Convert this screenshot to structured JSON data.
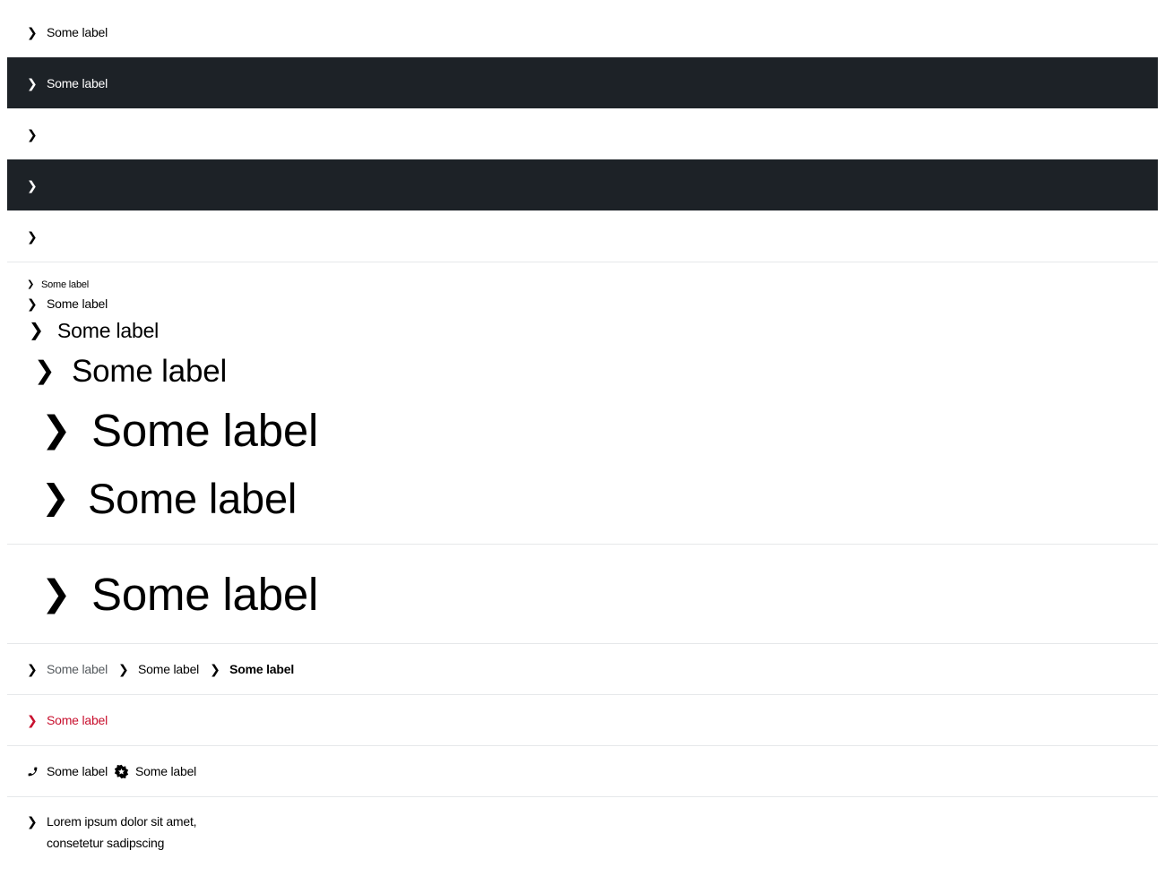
{
  "rows": {
    "r1": {
      "chevron": "❯",
      "label": "Some label"
    },
    "r2": {
      "chevron": "❯",
      "label": "Some label"
    },
    "r3": {
      "chevron": "❯"
    },
    "r4": {
      "chevron": "❯"
    },
    "r5": {
      "chevron": "❯"
    }
  },
  "sizes": {
    "xs": {
      "chevron": "❯",
      "label": "Some label"
    },
    "s": {
      "chevron": "❯",
      "label": "Some label"
    },
    "m": {
      "chevron": "❯",
      "label": "Some label"
    },
    "l": {
      "chevron": "❯",
      "label": "Some label"
    },
    "xl": {
      "chevron": "❯",
      "label": "Some label"
    },
    "xl2": {
      "chevron": "❯",
      "label": "Some label"
    }
  },
  "hero": {
    "chevron": "❯",
    "label": "Some label"
  },
  "weights": [
    {
      "chevron": "❯",
      "label": "Some label",
      "variant": "light"
    },
    {
      "chevron": "❯",
      "label": "Some label",
      "variant": "regular"
    },
    {
      "chevron": "❯",
      "label": "Some label",
      "variant": "bold"
    }
  ],
  "red_link": {
    "chevron": "❯",
    "label": "Some label",
    "color": "#c8102e"
  },
  "icon_links": [
    {
      "icon": "phone-icon",
      "label": "Some label"
    },
    {
      "icon": "badge-star-icon",
      "label": "Some label"
    }
  ],
  "multiline": {
    "chevron": "❯",
    "line1": "Lorem ipsum dolor sit amet,",
    "line2": "consetetur sadipscing"
  },
  "colors": {
    "dark_bg": "#1d2227",
    "divider": "#e6e8ea",
    "red": "#c8102e"
  }
}
